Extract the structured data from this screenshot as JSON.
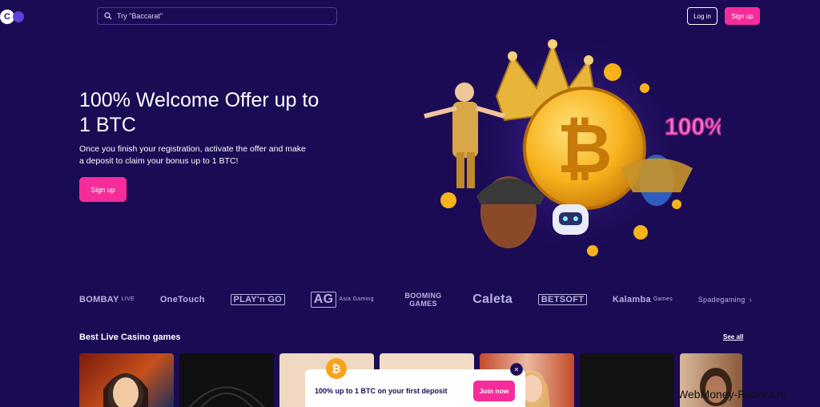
{
  "header": {
    "logo_letter": "C",
    "search_placeholder": "Try \"Baccarat\"",
    "login_label": "Log in",
    "signup_label": "Sign up"
  },
  "hero": {
    "title": "100% Welcome Offer up to 1 BTC",
    "description": "Once you finish your registration, activate the offer and make a deposit to claim your bonus up to 1 BTC!",
    "signup_label": "Sign up",
    "art_badge": "100%",
    "coin_symbol": "₿"
  },
  "providers": [
    {
      "name": "BOMBAY",
      "sub": "LIVE"
    },
    {
      "name": "OneTouch",
      "sub": ""
    },
    {
      "name": "PLAY'n GO",
      "sub": ""
    },
    {
      "name": "AG",
      "sub": "Asia Gaming"
    },
    {
      "name": "BOOMING GAMES",
      "sub": ""
    },
    {
      "name": "Caleta",
      "sub": ""
    },
    {
      "name": "BETSOFT",
      "sub": ""
    },
    {
      "name": "Kalamba",
      "sub": "Games"
    },
    {
      "name": "Spadegaming",
      "sub": ""
    }
  ],
  "section": {
    "title": "Best Live Casino games",
    "see_all": "See all"
  },
  "promo": {
    "text": "100% up to 1 BTC on your first deposit",
    "join_label": "Join now",
    "close": "✕",
    "coin": "₿"
  },
  "watermark": "WebMoney-Rabota.ru",
  "colors": {
    "background": "#1b0b54",
    "accent": "#f52c99",
    "coin": "#f7a31c"
  }
}
